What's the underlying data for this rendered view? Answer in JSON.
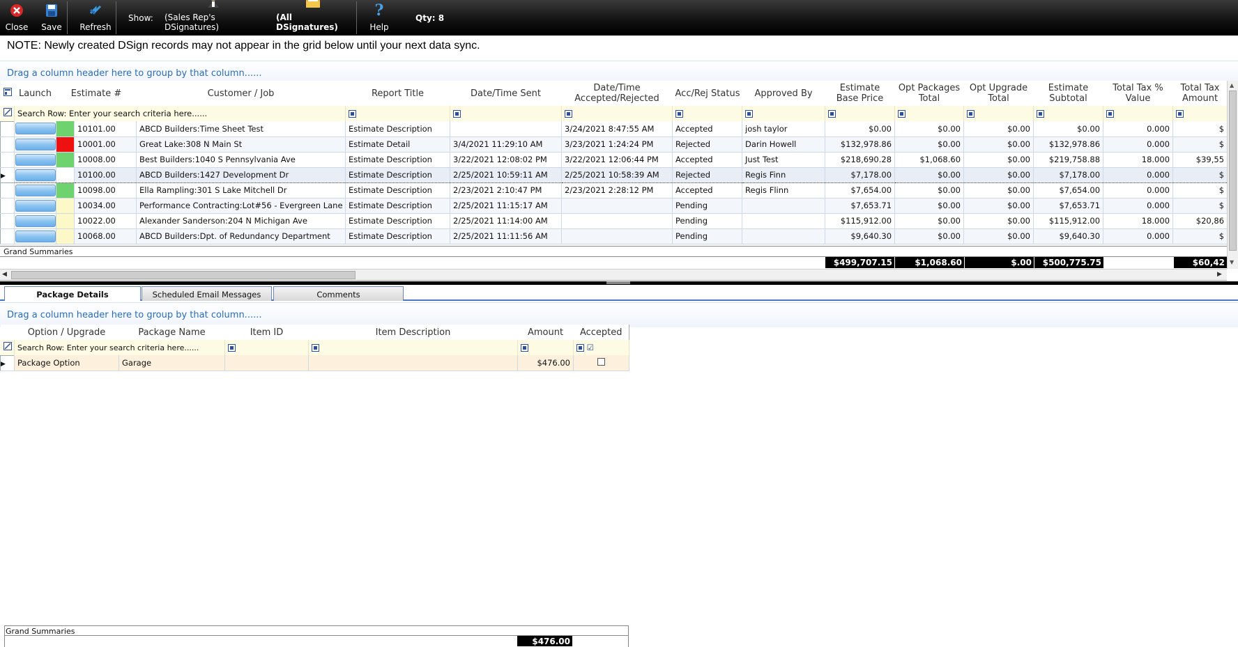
{
  "toolbar": {
    "close": "Close",
    "save": "Save",
    "refresh": "Refresh",
    "show": "Show:",
    "sales_rep": "(Sales Rep's DSignatures)",
    "all": "(All DSignatures)",
    "help": "Help",
    "qty": "Qty: 8"
  },
  "note": "NOTE: Newly created DSign records may not appear in the grid below until your next data sync.",
  "top_grid": {
    "group_hint": "Drag a column header here to group by that column......",
    "headers": [
      "Launch",
      "Estimate #",
      "Customer / Job",
      "Report Title",
      "Date/Time Sent",
      "Date/Time Accepted/Rejected",
      "Acc/Rej Status",
      "Approved By",
      "Estimate Base Price",
      "Opt Packages Total",
      "Opt Upgrade Total",
      "Estimate Subtotal",
      "Total Tax % Value",
      "Total Tax Amount"
    ],
    "search_hint": "Search Row: Enter your search criteria here......",
    "rows": [
      {
        "status_color": "#6ed36e",
        "est": "10101.00",
        "customer": "ABCD Builders:Time Sheet Test",
        "title": "Estimate Description",
        "sent": "",
        "accepted": "3/24/2021 8:47:55 AM",
        "status": "Accepted",
        "by": "josh taylor",
        "base": "$0.00",
        "pkg": "$0.00",
        "upg": "$0.00",
        "sub": "$0.00",
        "taxpct": "0.000",
        "taxamt": "$"
      },
      {
        "status_color": "#ee1111",
        "est": "10001.00",
        "customer": "Great Lake:308 N Main St",
        "title": "Estimate Detail",
        "sent": "3/4/2021 11:29:10 AM",
        "accepted": "3/23/2021 1:24:24 PM",
        "status": "Rejected",
        "by": "Darin Howell",
        "base": "$132,978.86",
        "pkg": "$0.00",
        "upg": "$0.00",
        "sub": "$132,978.86",
        "taxpct": "0.000",
        "taxamt": "$"
      },
      {
        "status_color": "#6ed36e",
        "est": "10008.00",
        "customer": "Best Builders:1040 S Pennsylvania Ave",
        "title": "Estimate Description",
        "sent": "3/22/2021 12:08:02 PM",
        "accepted": "3/22/2021 12:06:44 PM",
        "status": "Accepted",
        "by": "Just Test",
        "base": "$218,690.28",
        "pkg": "$1,068.60",
        "upg": "$0.00",
        "sub": "$219,758.88",
        "taxpct": "18.000",
        "taxamt": "$39,55"
      },
      {
        "status_color": "#ffffff",
        "est": "10100.00",
        "customer": "ABCD Builders:1427 Development Dr",
        "title": "Estimate Description",
        "sent": "2/25/2021 10:59:11 AM",
        "accepted": "2/25/2021 10:58:39 AM",
        "status": "Rejected",
        "by": "Regis Finn",
        "base": "$7,178.00",
        "pkg": "$0.00",
        "upg": "$0.00",
        "sub": "$7,178.00",
        "taxpct": "0.000",
        "taxamt": "$"
      },
      {
        "status_color": "#6ed36e",
        "est": "10098.00",
        "customer": "Ella Rampling:301 S Lake Mitchell Dr",
        "title": "Estimate Description",
        "sent": "2/23/2021 2:10:47 PM",
        "accepted": "2/23/2021 2:28:12 PM",
        "status": "Accepted",
        "by": "Regis Flinn",
        "base": "$7,654.00",
        "pkg": "$0.00",
        "upg": "$0.00",
        "sub": "$7,654.00",
        "taxpct": "0.000",
        "taxamt": "$"
      },
      {
        "status_color": "#fcf8c8",
        "est": "10034.00",
        "customer": "Performance Contracting:Lot#56 - Evergreen Lane",
        "title": "Estimate Description",
        "sent": "2/25/2021 11:15:17 AM",
        "accepted": "",
        "status": "Pending",
        "by": "",
        "base": "$7,653.71",
        "pkg": "$0.00",
        "upg": "$0.00",
        "sub": "$7,653.71",
        "taxpct": "0.000",
        "taxamt": "$"
      },
      {
        "status_color": "#fcf8c8",
        "est": "10022.00",
        "customer": "Alexander Sanderson:204 N Michigan Ave",
        "title": "Estimate Description",
        "sent": "2/25/2021 11:14:00 AM",
        "accepted": "",
        "status": "Pending",
        "by": "",
        "base": "$115,912.00",
        "pkg": "$0.00",
        "upg": "$0.00",
        "sub": "$115,912.00",
        "taxpct": "18.000",
        "taxamt": "$20,86"
      },
      {
        "status_color": "#fcf8c8",
        "est": "10068.00",
        "customer": "ABCD Builders:Dpt. of Redundancy Department",
        "title": "Estimate Description",
        "sent": "2/25/2021 11:11:56 AM",
        "accepted": "",
        "status": "Pending",
        "by": "",
        "base": "$9,640.30",
        "pkg": "$0.00",
        "upg": "$0.00",
        "sub": "$9,640.30",
        "taxpct": "0.000",
        "taxamt": "$"
      }
    ],
    "summary_label": "Grand Summaries",
    "totals": {
      "base": "$499,707.15",
      "pkg": "$1,068.60",
      "upg": "$.00",
      "sub": "$500,775.75",
      "taxamt": "$60,42"
    }
  },
  "tabs": [
    "Package Details",
    "Scheduled Email Messages",
    "Comments"
  ],
  "bottom_grid": {
    "group_hint": "Drag a column header here to group by that column......",
    "headers": [
      "Option / Upgrade",
      "Package Name",
      "Item ID",
      "Item Description",
      "Amount",
      "Accepted"
    ],
    "search_hint": "Search Row: Enter your search criteria here......",
    "rows": [
      {
        "option": "Package Option",
        "package": "Garage",
        "item_id": "",
        "desc": "",
        "amount": "$476.00"
      }
    ],
    "summary_label": "Grand Summaries",
    "total": "$476.00"
  },
  "colors": {
    "toolbar": "#111111",
    "accent": "#2a6cb8",
    "link": "#21208c"
  }
}
